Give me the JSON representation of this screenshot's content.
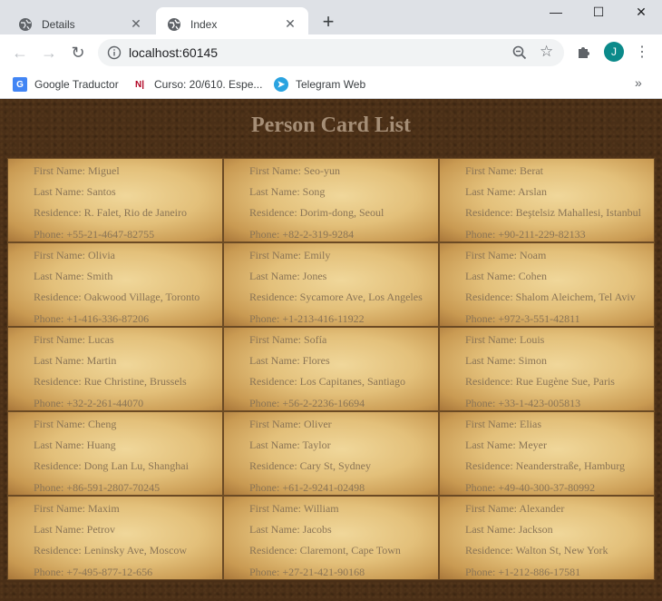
{
  "browser": {
    "tabs": [
      {
        "title": "Details",
        "active": false
      },
      {
        "title": "Index",
        "active": true
      }
    ],
    "new_tab_label": "+",
    "url": "localhost:60145",
    "profile_initial": "J",
    "bookmarks": [
      {
        "label": "Google Traductor",
        "icon": "google-translate-icon"
      },
      {
        "label": "Curso: 20/610. Espe...",
        "icon": "ni-icon"
      },
      {
        "label": "Telegram Web",
        "icon": "telegram-icon"
      }
    ],
    "more_bookmarks": "»"
  },
  "page": {
    "title": "Person Card List",
    "labels": {
      "first": "First Name: ",
      "last": "Last Name: ",
      "residence": "Residence: ",
      "phone": "Phone: "
    },
    "people": [
      {
        "first": "Miguel",
        "last": "Santos",
        "residence": "R. Falet, Rio de Janeiro",
        "phone": "+55-21-4647-82755"
      },
      {
        "first": "Seo-yun",
        "last": "Song",
        "residence": "Dorim-dong, Seoul",
        "phone": "+82-2-319-9284"
      },
      {
        "first": "Berat",
        "last": "Arslan",
        "residence": "Beştelsiz Mahallesi, Istanbul",
        "phone": "+90-211-229-82133"
      },
      {
        "first": "Olivia",
        "last": "Smith",
        "residence": "Oakwood Village, Toronto",
        "phone": "+1-416-336-87206"
      },
      {
        "first": "Emily",
        "last": "Jones",
        "residence": "Sycamore Ave, Los Angeles",
        "phone": "+1-213-416-11922"
      },
      {
        "first": "Noam",
        "last": "Cohen",
        "residence": "Shalom Aleichem, Tel Aviv",
        "phone": "+972-3-551-42811"
      },
      {
        "first": "Lucas",
        "last": "Martin",
        "residence": "Rue Christine, Brussels",
        "phone": "+32-2-261-44070"
      },
      {
        "first": "Sofía",
        "last": "Flores",
        "residence": "Los Capitanes, Santiago",
        "phone": "+56-2-2236-16694"
      },
      {
        "first": "Louis",
        "last": "Simon",
        "residence": "Rue Eugène Sue, Paris",
        "phone": "+33-1-423-005813"
      },
      {
        "first": "Cheng",
        "last": "Huang",
        "residence": "Dong Lan Lu, Shanghai",
        "phone": "+86-591-2807-70245"
      },
      {
        "first": "Oliver",
        "last": "Taylor",
        "residence": "Cary St, Sydney",
        "phone": "+61-2-9241-02498"
      },
      {
        "first": "Elias",
        "last": "Meyer",
        "residence": "Neanderstraße, Hamburg",
        "phone": "+49-40-300-37-80992"
      },
      {
        "first": "Maxim",
        "last": "Petrov",
        "residence": "Leninsky Ave, Moscow",
        "phone": "+7-495-877-12-656"
      },
      {
        "first": "William",
        "last": "Jacobs",
        "residence": "Claremont, Cape Town",
        "phone": "+27-21-421-90168"
      },
      {
        "first": "Alexander",
        "last": "Jackson",
        "residence": "Walton St, New York",
        "phone": "+1-212-886-17581"
      }
    ]
  }
}
